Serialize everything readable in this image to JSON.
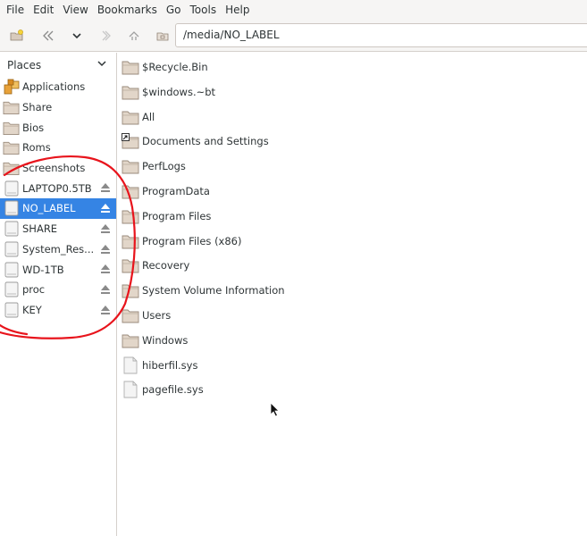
{
  "menu": [
    "File",
    "Edit",
    "View",
    "Bookmarks",
    "Go",
    "Tools",
    "Help"
  ],
  "toolbar": {
    "location": "/media/NO_LABEL",
    "buttons": [
      "new-folder-icon",
      "back-icon",
      "history-dropdown-icon",
      "forward-icon",
      "up-icon",
      "home-icon"
    ]
  },
  "sidebar": {
    "header": "Places",
    "items": [
      {
        "label": "Applications",
        "icon": "applications-icon",
        "eject": false,
        "selected": false
      },
      {
        "label": "Share",
        "icon": "folder-icon",
        "eject": false,
        "selected": false
      },
      {
        "label": "Bios",
        "icon": "folder-icon",
        "eject": false,
        "selected": false
      },
      {
        "label": "Roms",
        "icon": "folder-icon",
        "eject": false,
        "selected": false
      },
      {
        "label": "Screenshots",
        "icon": "folder-icon",
        "eject": false,
        "selected": false
      },
      {
        "label": "LAPTOP0.5TB",
        "icon": "drive-icon",
        "eject": true,
        "selected": false
      },
      {
        "label": "NO_LABEL",
        "icon": "drive-icon",
        "eject": true,
        "selected": true
      },
      {
        "label": "SHARE",
        "icon": "drive-icon",
        "eject": true,
        "selected": false
      },
      {
        "label": "System_Res...",
        "icon": "drive-icon",
        "eject": true,
        "selected": false
      },
      {
        "label": "WD-1TB",
        "icon": "drive-icon",
        "eject": true,
        "selected": false
      },
      {
        "label": "proc",
        "icon": "drive-icon",
        "eject": true,
        "selected": false
      },
      {
        "label": "KEY",
        "icon": "drive-icon",
        "eject": true,
        "selected": false
      }
    ]
  },
  "files": [
    {
      "name": "$Recycle.Bin",
      "icon": "folder-icon"
    },
    {
      "name": "$windows.~bt",
      "icon": "folder-icon"
    },
    {
      "name": "All",
      "icon": "folder-icon"
    },
    {
      "name": "Documents and Settings",
      "icon": "folder-link-icon"
    },
    {
      "name": "PerfLogs",
      "icon": "folder-icon"
    },
    {
      "name": "ProgramData",
      "icon": "folder-icon"
    },
    {
      "name": "Program Files",
      "icon": "folder-icon"
    },
    {
      "name": "Program Files (x86)",
      "icon": "folder-icon"
    },
    {
      "name": "Recovery",
      "icon": "folder-icon"
    },
    {
      "name": "System Volume Information",
      "icon": "folder-icon"
    },
    {
      "name": "Users",
      "icon": "folder-icon"
    },
    {
      "name": "Windows",
      "icon": "folder-icon"
    },
    {
      "name": "hiberfil.sys",
      "icon": "file-icon"
    },
    {
      "name": "pagefile.sys",
      "icon": "file-icon"
    }
  ],
  "colors": {
    "selection": "#3584e4",
    "annotation": "#e8141c",
    "folder": "#c4b5a5"
  }
}
